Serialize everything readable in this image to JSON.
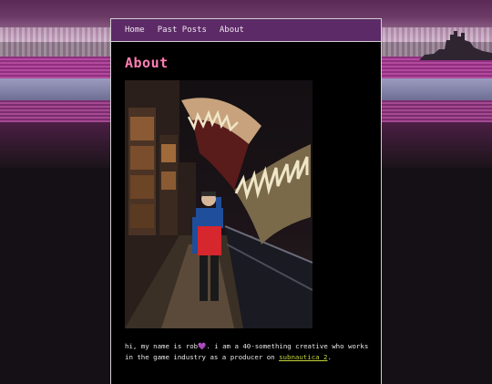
{
  "nav": {
    "items": [
      {
        "label": "Home"
      },
      {
        "label": "Past Posts"
      },
      {
        "label": "About"
      }
    ]
  },
  "page": {
    "title": "About"
  },
  "intro": {
    "before_heart": "hi, my name is rob",
    "heart": "💜",
    "after_heart": ". i am a 40-something creative who works in the game industry as a producer on ",
    "link_text": "subnautica 2",
    "after_link": "."
  },
  "colors": {
    "nav_bg": "#5c2a66",
    "title": "#ff7fb4",
    "link": "#c3d33a",
    "page_bg": "#000000"
  }
}
